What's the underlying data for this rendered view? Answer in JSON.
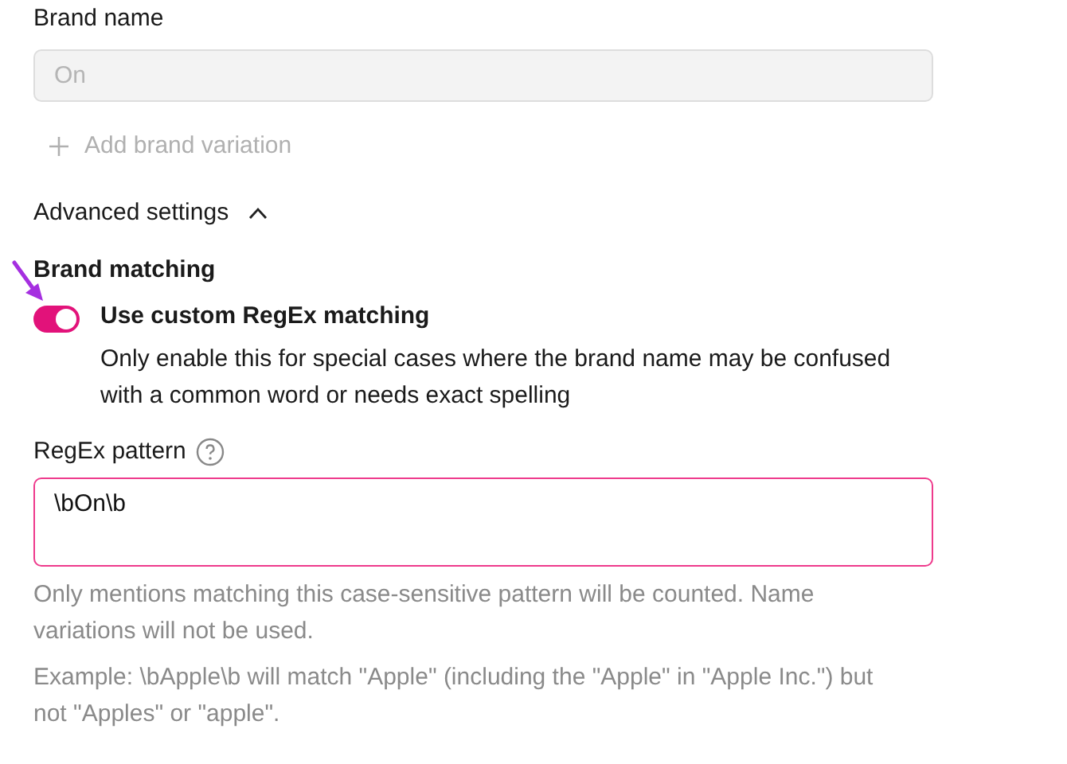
{
  "brand_name": {
    "label": "Brand name",
    "placeholder": "On",
    "disabled": true
  },
  "add_variation": {
    "label": "Add brand variation",
    "disabled": true
  },
  "advanced_settings": {
    "label": "Advanced settings",
    "expanded": true
  },
  "brand_matching": {
    "heading": "Brand matching",
    "toggle": {
      "on": true,
      "title": "Use custom RegEx matching",
      "description": "Only enable this for special cases where the brand name may be confused with a common word or needs exact spelling"
    }
  },
  "regex_pattern": {
    "label": "RegEx pattern",
    "value": "\\bOn\\b",
    "help": [
      "Only mentions matching this case-sensitive pattern will be counted. Name variations will not be used.",
      "Example: \\bApple\\b will match \"Apple\" (including the \"Apple\" in \"Apple Inc.\") but not \"Apples\" or \"apple\"."
    ]
  }
}
